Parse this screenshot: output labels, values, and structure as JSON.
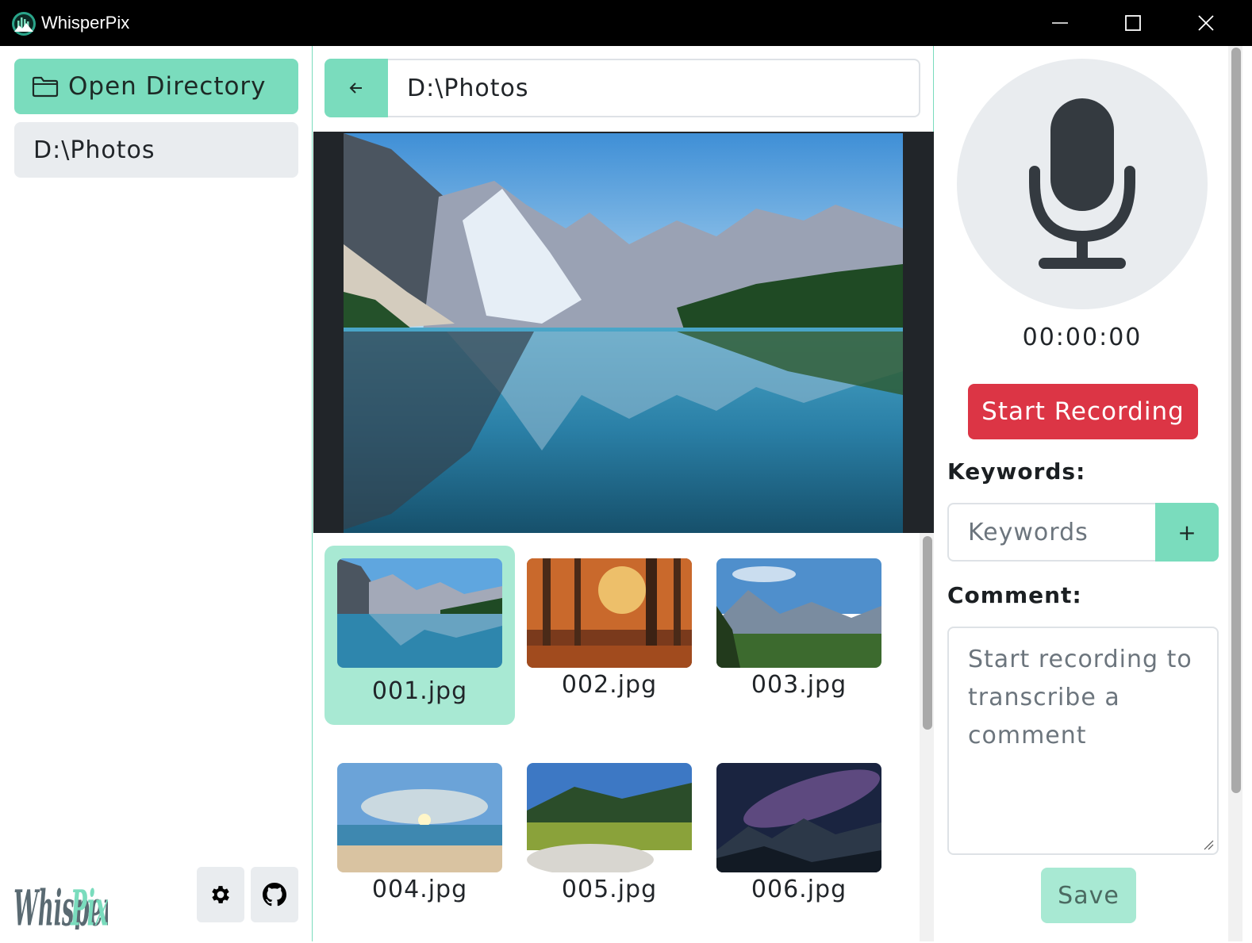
{
  "window": {
    "title": "WhisperPix",
    "controls": [
      "minimize",
      "maximize",
      "close"
    ]
  },
  "sidebar": {
    "open_directory_label": "Open Directory",
    "directories": [
      "D:\\Photos"
    ],
    "logo_text": "WhisperPix",
    "icons": [
      "folder-icon",
      "gear-icon",
      "github-icon"
    ]
  },
  "browser": {
    "path": "D:\\Photos",
    "back_icon": "arrow-left-icon",
    "thumbnails": [
      {
        "label": "001.jpg",
        "selected": true
      },
      {
        "label": "002.jpg",
        "selected": false
      },
      {
        "label": "003.jpg",
        "selected": false
      },
      {
        "label": "004.jpg",
        "selected": false
      },
      {
        "label": "005.jpg",
        "selected": false
      },
      {
        "label": "006.jpg",
        "selected": false
      }
    ]
  },
  "recorder": {
    "mic_icon": "microphone-icon",
    "timer": "00:00:00",
    "start_label": "Start Recording",
    "keywords_label": "Keywords:",
    "keywords_placeholder": "Keywords",
    "add_label": "+",
    "comment_label": "Comment:",
    "comment_placeholder": "Start recording to transcribe a comment",
    "save_label": "Save"
  },
  "colors": {
    "accent": "#7adcbd",
    "accent_light": "#a8e9d3",
    "danger": "#dc3545",
    "neutral": "#e9ecef",
    "preview_bg": "#212529"
  }
}
